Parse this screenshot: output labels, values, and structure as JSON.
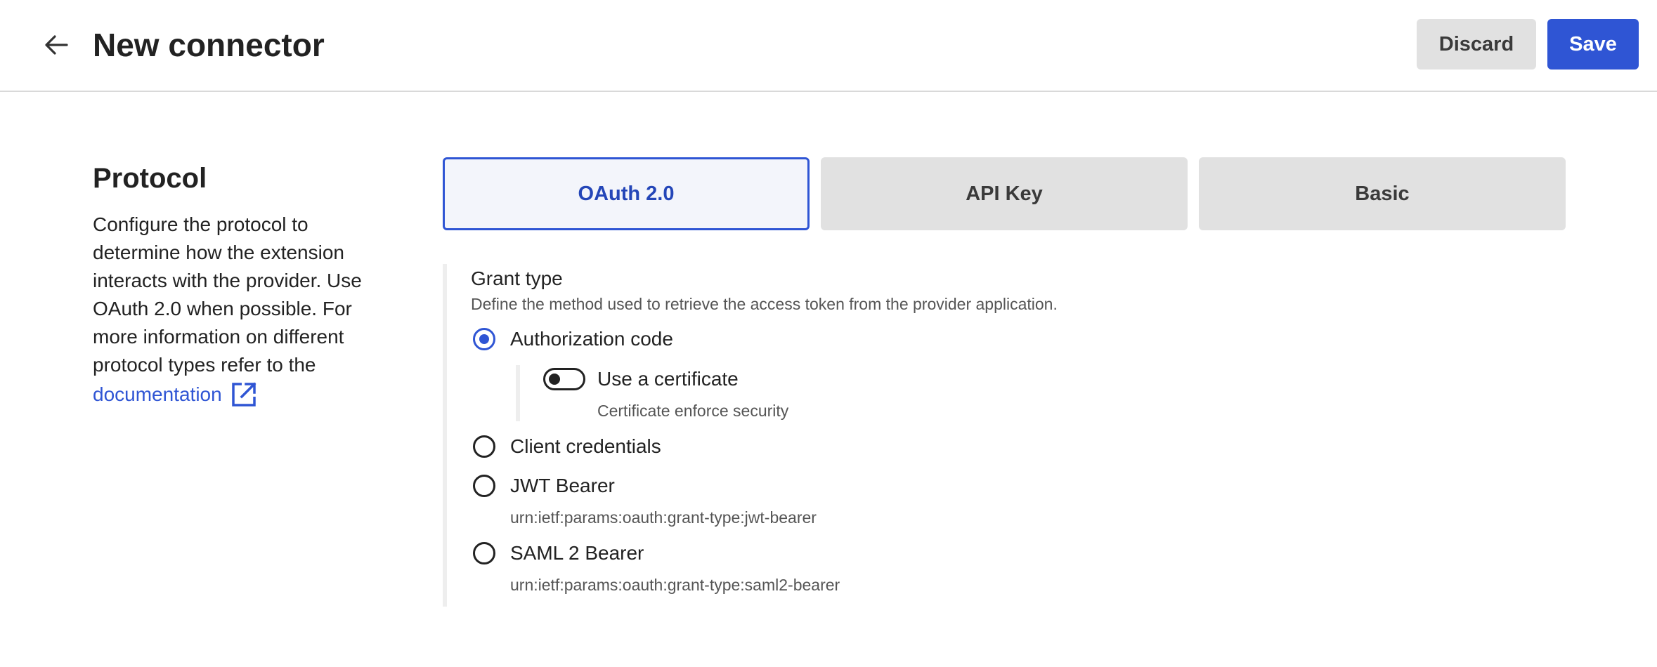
{
  "header": {
    "back_icon": "arrow-left-icon",
    "title": "New connector",
    "discard_label": "Discard",
    "save_label": "Save"
  },
  "protocol": {
    "title": "Protocol",
    "description": "Configure the protocol to determine how the extension interacts with the provider. Use OAuth 2.0 when possible. For more information on different protocol types refer to the",
    "link_label": "documentation",
    "link_icon": "external-link-icon",
    "tabs": [
      {
        "label": "OAuth 2.0",
        "selected": true
      },
      {
        "label": "API Key",
        "selected": false
      },
      {
        "label": "Basic",
        "selected": false
      }
    ]
  },
  "grant_type": {
    "label": "Grant type",
    "description": "Define the method used to retrieve the access token from the provider application.",
    "options": [
      {
        "label": "Authorization code",
        "subtext": "",
        "checked": true
      },
      {
        "label": "Client credentials",
        "subtext": "",
        "checked": false
      },
      {
        "label": "JWT Bearer",
        "subtext": "urn:ietf:params:oauth:grant-type:jwt-bearer",
        "checked": false
      },
      {
        "label": "SAML 2 Bearer",
        "subtext": "urn:ietf:params:oauth:grant-type:saml2-bearer",
        "checked": false
      }
    ],
    "certificate": {
      "label": "Use a certificate",
      "subtext": "Certificate enforce security",
      "enabled": false
    }
  },
  "colors": {
    "accent": "#2f55d4",
    "tab_inactive": "#e1e1e1",
    "divider": "#d9d9d9"
  }
}
